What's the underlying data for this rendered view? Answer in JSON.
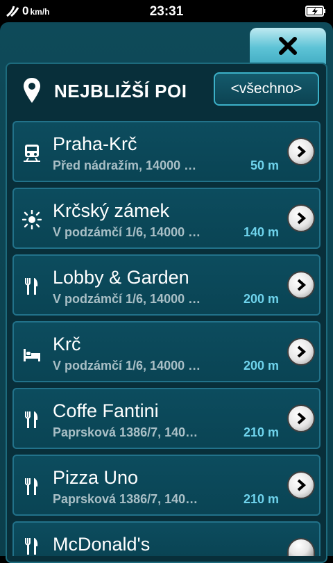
{
  "status": {
    "speed": "0",
    "speed_unit": "km/h",
    "time": "23:31"
  },
  "header": {
    "title": "NEJBLIŽŠÍ POI",
    "filter_label": "<všechno>"
  },
  "items": [
    {
      "icon": "train-icon",
      "name": "Praha-Krč",
      "address": "Před nádražím, 14000 …",
      "distance": "50 m"
    },
    {
      "icon": "sightseeing-icon",
      "name": "Krčský zámek",
      "address": "V podzámčí 1/6, 14000 …",
      "distance": "140 m"
    },
    {
      "icon": "restaurant-icon",
      "name": "Lobby & Garden",
      "address": "V podzámčí 1/6, 14000 …",
      "distance": "200 m"
    },
    {
      "icon": "hotel-bed-icon",
      "name": "Krč",
      "address": "V podzámčí 1/6, 14000 …",
      "distance": "200 m"
    },
    {
      "icon": "restaurant-icon",
      "name": "Coffe Fantini",
      "address": "Paprsková 1386/7, 140…",
      "distance": "210 m"
    },
    {
      "icon": "restaurant-icon",
      "name": "Pizza Uno",
      "address": "Paprsková 1386/7, 140…",
      "distance": "210 m"
    },
    {
      "icon": "restaurant-icon",
      "name": "McDonald's",
      "address": "",
      "distance": ""
    }
  ],
  "colors": {
    "accent": "#6fd3ec",
    "panel": "#082f3a",
    "row_border": "#22728a"
  }
}
